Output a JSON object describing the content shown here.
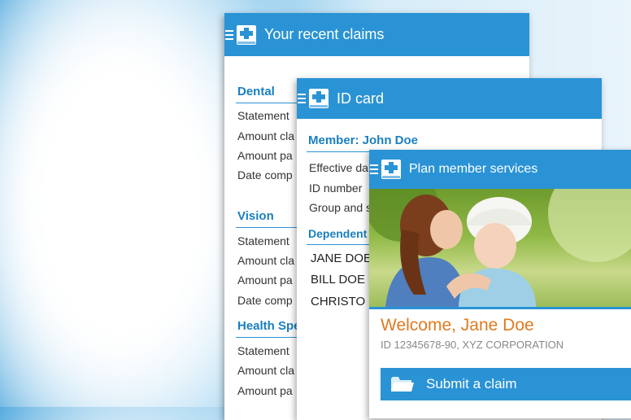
{
  "colors": {
    "accent": "#2a93d5",
    "section": "#1a7fc0",
    "welcome": "#e07a1f"
  },
  "claims": {
    "title": "Your recent claims",
    "sections": [
      {
        "title": "Dental",
        "rows": [
          "Statement",
          "Amount cla",
          "Amount pa",
          "Date comp"
        ]
      },
      {
        "title": "Vision",
        "rows": [
          "Statement",
          "Amount cla",
          "Amount pa",
          "Date comp"
        ]
      },
      {
        "title": "Health Spe",
        "rows": [
          "Statement",
          "Amount cla",
          "Amount pa"
        ]
      }
    ]
  },
  "idcard": {
    "title": "ID card",
    "member": "Member: John Doe",
    "rows": [
      "Effective da",
      "ID number",
      "Group and s"
    ],
    "dependents_title": "Dependent",
    "dependents": [
      "JANE DOE",
      "BILL DOE",
      "CHRISTO"
    ]
  },
  "services": {
    "title": "Plan member services",
    "photo_icon": "mother-kissing-baby-photo",
    "welcome": "Welcome, Jane Doe",
    "member_id": "ID 12345678-90, XYZ CORPORATION",
    "submit_label": "Submit a claim",
    "submit_icon": "folder-icon"
  }
}
